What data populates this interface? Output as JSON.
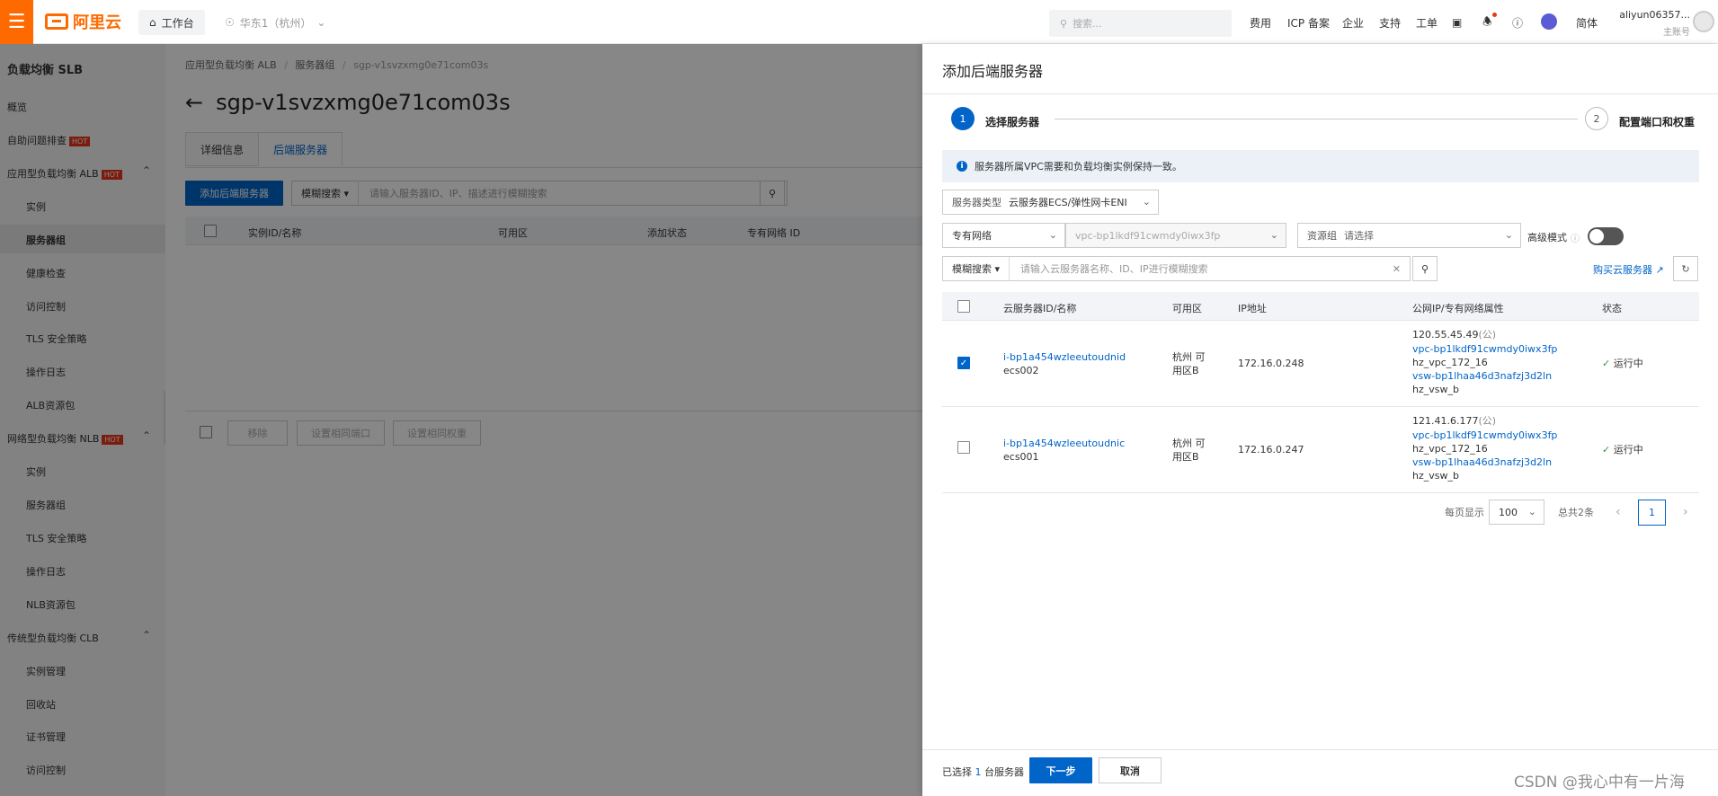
{
  "topbar": {
    "logo_text": "阿里云",
    "workbench_label": "工作台",
    "region_label": "华东1（杭州）",
    "search_placeholder": "搜索...",
    "nav": [
      "费用",
      "ICP 备案",
      "企业",
      "支持",
      "工单"
    ],
    "lang_label": "简体",
    "user_name": "aliyun06357...",
    "user_role": "主账号"
  },
  "sidebar": {
    "title": "负载均衡 SLB",
    "overview": "概览",
    "self_check": "自助问题排查",
    "alb_group": "应用型负载均衡 ALB",
    "alb_items": [
      "实例",
      "服务器组",
      "健康检查",
      "访问控制",
      "TLS 安全策略",
      "操作日志",
      "ALB资源包"
    ],
    "nlb_group": "网络型负载均衡 NLB",
    "nlb_items": [
      "实例",
      "服务器组",
      "TLS 安全策略",
      "操作日志",
      "NLB资源包"
    ],
    "clb_group": "传统型负载均衡 CLB",
    "clb_items": [
      "实例管理",
      "回收站",
      "证书管理",
      "访问控制"
    ],
    "hot_badge": "HOT"
  },
  "main": {
    "breadcrumb": [
      "应用型负载均衡 ALB",
      "服务器组",
      "sgp-v1svzxmg0e71com03s"
    ],
    "page_title": "sgp-v1svzxmg0e71com03s",
    "tabs": [
      "详细信息",
      "后端服务器"
    ],
    "add_button": "添加后端服务器",
    "fuzzy_search": "模糊搜索",
    "search_placeholder": "请输入服务器ID、IP、描述进行模糊搜索",
    "columns": [
      "实例ID/名称",
      "可用区",
      "添加状态",
      "专有网络 ID"
    ],
    "bottom_buttons": [
      "移除",
      "设置相同端口",
      "设置相同权重"
    ]
  },
  "drawer": {
    "title": "添加后端服务器",
    "steps": [
      {
        "num": "1",
        "label": "选择服务器"
      },
      {
        "num": "2",
        "label": "配置端口和权重"
      }
    ],
    "notice": "服务器所属VPC需要和负载均衡实例保持一致。",
    "server_type_label": "服务器类型",
    "server_type_value": "云服务器ECS/弹性网卡ENI",
    "network_type": "专有网络",
    "vpc_value": "vpc-bp1lkdf91cwmdy0iwx3fp",
    "resource_group_label": "资源组",
    "resource_group_value": "请选择",
    "advanced_label": "高级模式",
    "fuzzy_search": "模糊搜索",
    "search_placeholder": "请输入云服务器名称、ID、IP进行模糊搜索",
    "buy_link": "购买云服务器",
    "columns": [
      "云服务器ID/名称",
      "可用区",
      "IP地址",
      "公网IP/专有网络属性",
      "状态"
    ],
    "rows": [
      {
        "id": "i-bp1a454wzleeutoudnid",
        "name": "ecs002",
        "zone": "杭州 可用区B",
        "ip": "172.16.0.248",
        "public_ip": "120.55.45.49",
        "public_suffix": "(公)",
        "vpc": "vpc-bp1lkdf91cwmdy0iwx3fp",
        "vpc_name": "hz_vpc_172_16",
        "vsw": "vsw-bp1lhaa46d3nafzj3d2ln",
        "vsw_name": "hz_vsw_b",
        "status": "运行中",
        "checked": true
      },
      {
        "id": "i-bp1a454wzleeutoudnic",
        "name": "ecs001",
        "zone": "杭州 可用区B",
        "ip": "172.16.0.247",
        "public_ip": "121.41.6.177",
        "public_suffix": "(公)",
        "vpc": "vpc-bp1lkdf91cwmdy0iwx3fp",
        "vpc_name": "hz_vpc_172_16",
        "vsw": "vsw-bp1lhaa46d3nafzj3d2ln",
        "vsw_name": "hz_vsw_b",
        "status": "运行中",
        "checked": false
      }
    ],
    "pager": {
      "per_page_label": "每页显示",
      "per_page": "100",
      "total": "总共2条",
      "page": "1"
    },
    "footer": {
      "selected_prefix": "已选择",
      "selected_count": "1",
      "selected_suffix": "台服务器",
      "next": "下一步",
      "cancel": "取消"
    }
  },
  "watermark": "CSDN @我心中有一片海"
}
